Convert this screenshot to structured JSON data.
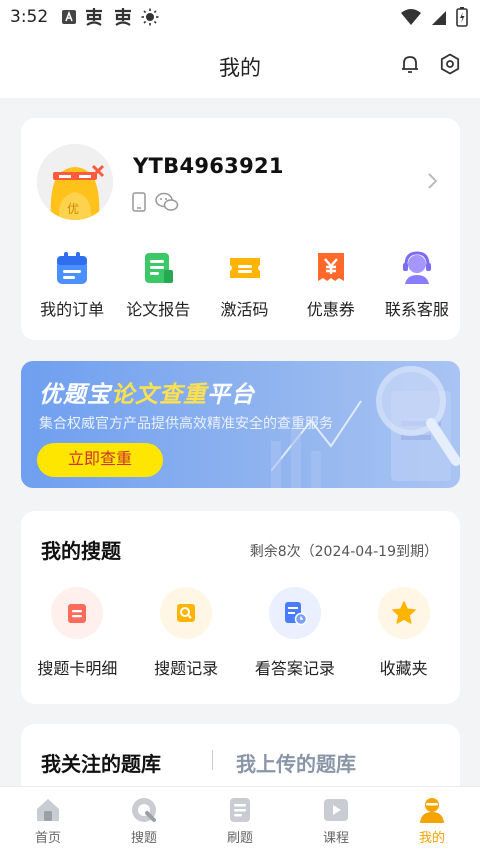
{
  "status_bar": {
    "time": "3:52"
  },
  "header": {
    "title": "我的"
  },
  "profile": {
    "username": "YTB4963921",
    "avatar_badge": "优"
  },
  "quick_actions": [
    {
      "label": "我的订单",
      "icon": "calendar-icon",
      "color": "#4a90ff"
    },
    {
      "label": "论文报告",
      "icon": "document-icon",
      "color": "#3cc768"
    },
    {
      "label": "激活码",
      "icon": "ticket-icon",
      "color": "#ffb400"
    },
    {
      "label": "优惠券",
      "icon": "coupon-icon",
      "color": "#ff6a2b"
    },
    {
      "label": "联系客服",
      "icon": "headset-icon",
      "color": "#8a7cff"
    }
  ],
  "banner": {
    "title_prefix": "优题宝",
    "title_highlight": "论文查重",
    "title_suffix": "平台",
    "subtitle": "集合权威官方产品提供高效精准安全的查重服务",
    "button_label": "立即查重"
  },
  "my_search": {
    "title": "我的搜题",
    "remaining": "剩余8次（2024-04-19到期）",
    "items": [
      {
        "label": "搜题卡明细",
        "icon": "card-detail-icon",
        "color": "#ff6b5b",
        "bg": "#fff0ee"
      },
      {
        "label": "搜题记录",
        "icon": "search-record-icon",
        "color": "#ffb400",
        "bg": "#fff6e5"
      },
      {
        "label": "看答案记录",
        "icon": "answer-record-icon",
        "color": "#4a7cff",
        "bg": "#eaf0ff"
      },
      {
        "label": "收藏夹",
        "icon": "star-icon",
        "color": "#ffb400",
        "bg": "#fff6e5"
      }
    ]
  },
  "library_tabs": {
    "active": "我关注的题库",
    "inactive": "我上传的题库"
  },
  "bottom_nav": [
    {
      "label": "首页",
      "icon": "home-icon",
      "active": false
    },
    {
      "label": "搜题",
      "icon": "search-tab-icon",
      "active": false
    },
    {
      "label": "刷题",
      "icon": "practice-icon",
      "active": false
    },
    {
      "label": "课程",
      "icon": "play-icon",
      "active": false
    },
    {
      "label": "我的",
      "icon": "user-icon",
      "active": true
    }
  ],
  "colors": {
    "accent": "#f5a300",
    "banner_button": "#ffe600",
    "banner_highlight": "#ffe14d"
  }
}
